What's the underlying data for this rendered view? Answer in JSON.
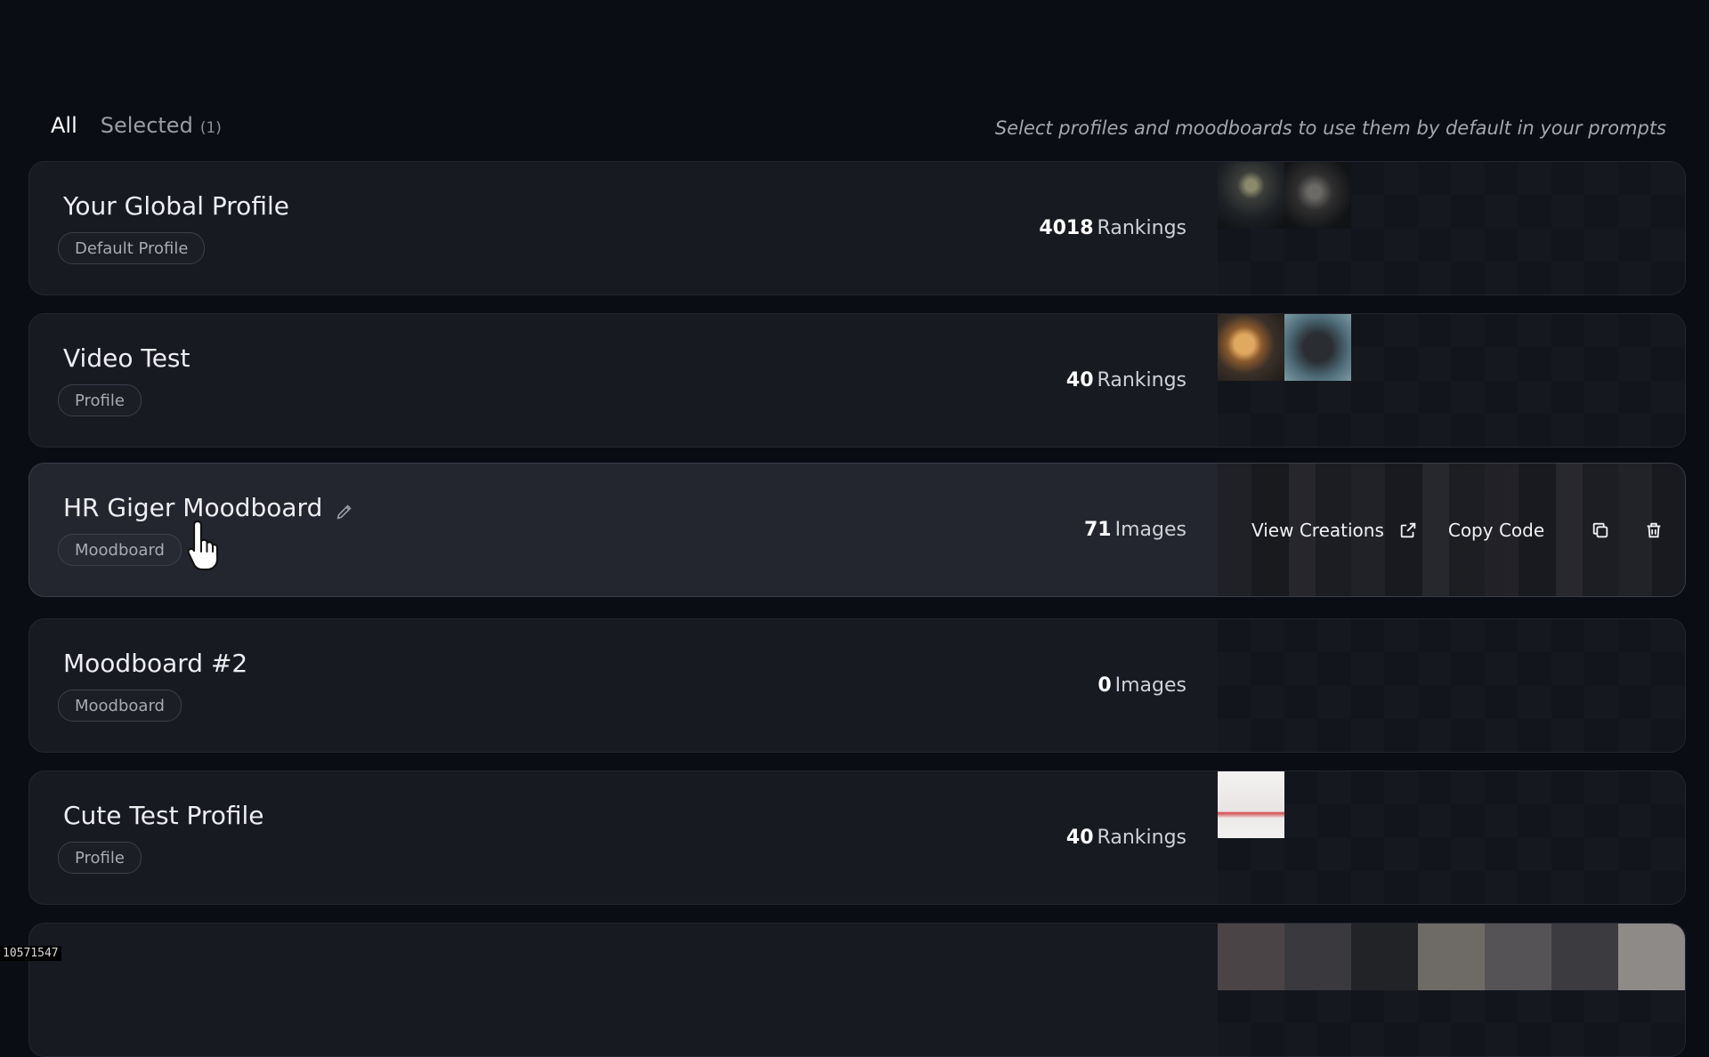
{
  "tabs": {
    "all": "All",
    "selected": "Selected",
    "selected_count": "(1)"
  },
  "hint": "Select profiles and moodboards to use them by default in your prompts",
  "cards": [
    {
      "title": "Your Global Profile",
      "badge": "Default Profile",
      "count_num": "4018",
      "count_label": "Rankings"
    },
    {
      "title": "Video Test",
      "badge": "Profile",
      "count_num": "40",
      "count_label": "Rankings"
    },
    {
      "title": "HR Giger Moodboard",
      "badge": "Moodboard",
      "count_num": "71",
      "count_label": "Images"
    },
    {
      "title": "Moodboard #2",
      "badge": "Moodboard",
      "count_num": "0",
      "count_label": "Images"
    },
    {
      "title": "Cute Test Profile",
      "badge": "Profile",
      "count_num": "40",
      "count_label": "Rankings"
    }
  ],
  "actions": {
    "view_creations": "View Creations",
    "copy_code": "Copy Code"
  },
  "status": "10571547",
  "icons": [
    "pencil-icon",
    "external-link-icon",
    "copy-icon",
    "trash-icon",
    "hand-cursor-icon"
  ]
}
